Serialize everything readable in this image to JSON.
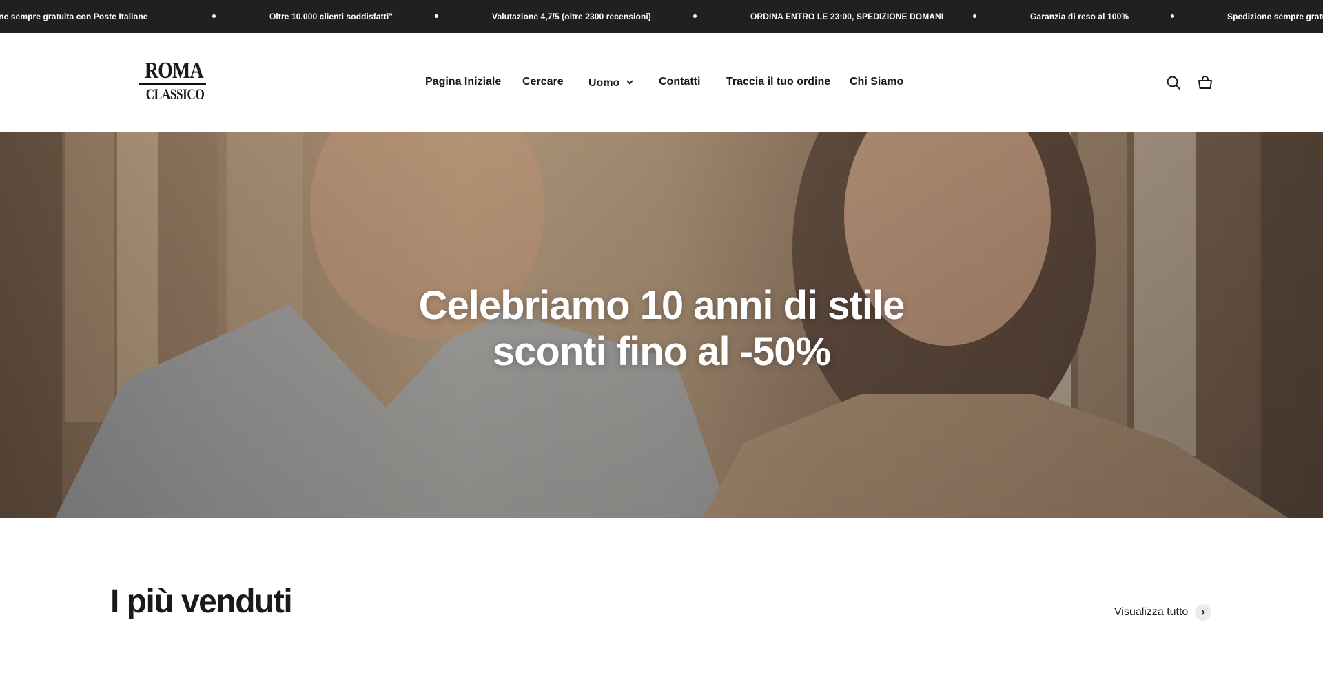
{
  "announcement": {
    "messages": [
      "Spedizione sempre gratuita con Poste Italiane",
      "Oltre 10.000 clienti soddisfatti\"",
      "Valutazione 4,7/5 (oltre 2300 recensioni)",
      "ORDINA ENTRO LE 23:00, SPEDIZIONE DOMANI",
      "Garanzia di reso al 100%",
      "Spedizione sempre gratuita con Poste Italiane"
    ]
  },
  "header": {
    "logo_line1": "ROMA",
    "logo_line2": "CLASSICO",
    "nav": [
      {
        "label": "Pagina Iniziale"
      },
      {
        "label": "Cercare"
      },
      {
        "label": "Uomo",
        "has_dropdown": true
      },
      {
        "label": "Contatti"
      },
      {
        "label": "Traccia il tuo ordine"
      },
      {
        "label": "Chi Siamo"
      }
    ],
    "icons": [
      "search-icon",
      "cart-icon"
    ]
  },
  "hero": {
    "title_line1": "Celebriamo 10 anni di stile",
    "title_line2": "sconti fino al -50%"
  },
  "bestsellers": {
    "title": "I più venduti",
    "view_all_label": "Visualizza tutto",
    "view_all_icon": "chevron-right-icon"
  },
  "colors": {
    "announcement_bg": "#1f2022",
    "text": "#1a1a1a",
    "accent_circle": "#ececec"
  }
}
